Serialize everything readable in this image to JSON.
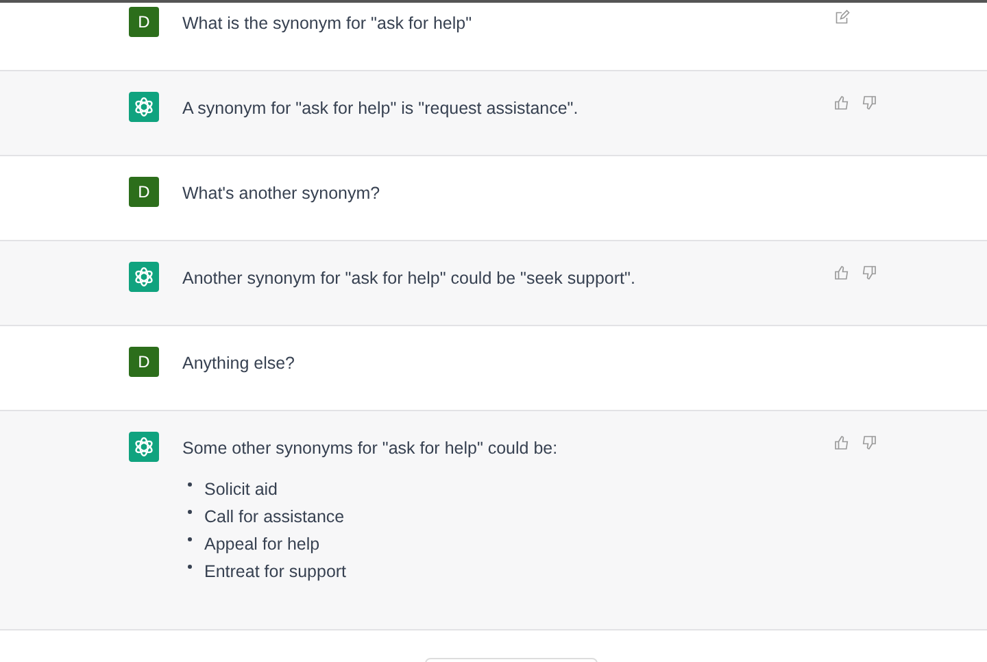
{
  "messages": [
    {
      "kind": "user",
      "avatar": "D",
      "editable": true,
      "text": "What is the synonym for \"ask for help\""
    },
    {
      "kind": "assistant",
      "text": "A synonym for \"ask for help\" is \"request assistance\"."
    },
    {
      "kind": "user",
      "avatar": "D",
      "editable": false,
      "text": "What's another synonym?"
    },
    {
      "kind": "assistant",
      "text": "Another synonym for \"ask for help\" could be \"seek support\"."
    },
    {
      "kind": "user",
      "avatar": "D",
      "editable": false,
      "text": "Anything else?"
    },
    {
      "kind": "assistant",
      "text": "Some other synonyms for \"ask for help\" could be:",
      "bullets": [
        "Solicit aid",
        "Call for assistance",
        "Appeal for help",
        "Entreat for support"
      ]
    }
  ]
}
